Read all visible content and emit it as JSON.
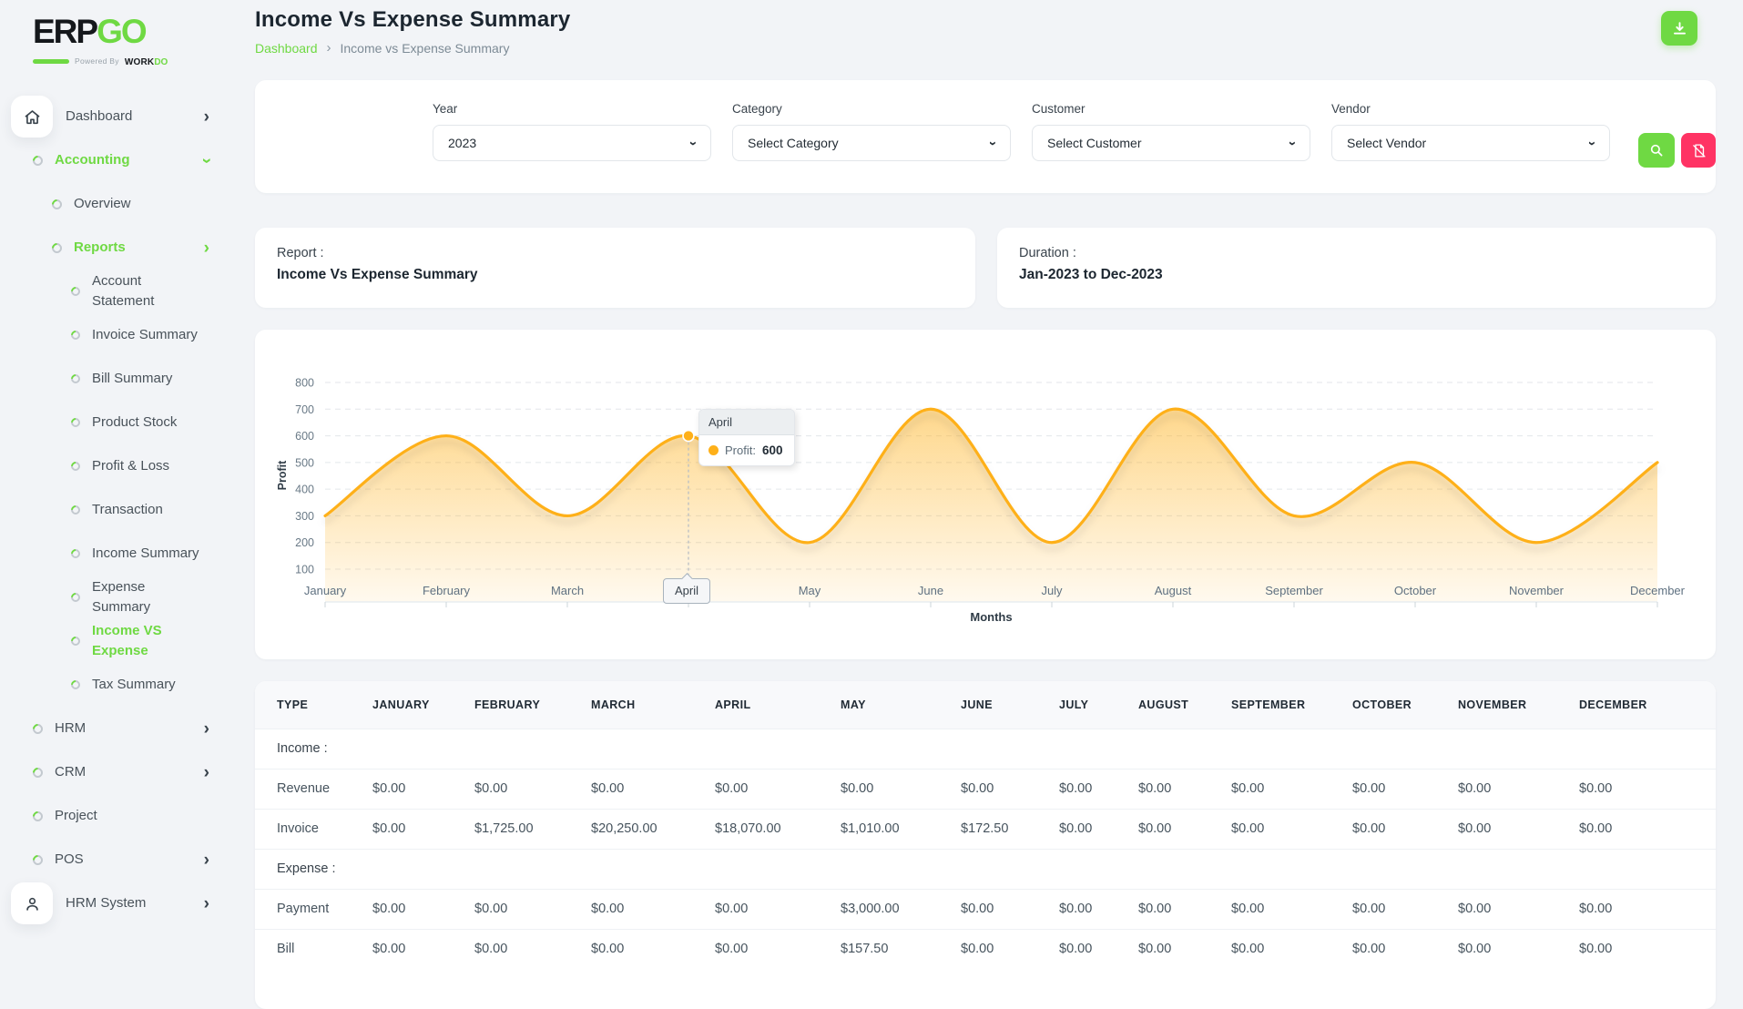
{
  "brand": {
    "name_black": "ERP",
    "name_green": "GO",
    "powered_by": "Powered By",
    "powered_black": "WORK",
    "powered_green": "DO"
  },
  "header": {
    "title": "Income Vs Expense Summary",
    "breadcrumb_link": "Dashboard",
    "breadcrumb_current": "Income vs Expense Summary"
  },
  "filters": {
    "fields": [
      {
        "name": "year-select",
        "label": "Year",
        "value": "2023"
      },
      {
        "name": "category-select",
        "label": "Category",
        "value": "Select Category"
      },
      {
        "name": "customer-select",
        "label": "Customer",
        "value": "Select Customer"
      },
      {
        "name": "vendor-select",
        "label": "Vendor",
        "value": "Select Vendor"
      }
    ]
  },
  "summary_cards": {
    "report_label": "Report :",
    "report_value": "Income Vs Expense Summary",
    "duration_label": "Duration :",
    "duration_value": "Jan-2023 to Dec-2023"
  },
  "sidebar": {
    "items": [
      {
        "name": "sidebar-item-dashboard",
        "label": "Dashboard",
        "level": "main",
        "icon": "home-icon",
        "chevron": "right",
        "active": false
      },
      {
        "name": "sidebar-item-accounting",
        "label": "Accounting",
        "level": "main",
        "bullet": true,
        "chevron": "down",
        "active": true
      },
      {
        "name": "sidebar-item-overview",
        "label": "Overview",
        "level": "sub",
        "bullet": true,
        "active": false
      },
      {
        "name": "sidebar-item-reports",
        "label": "Reports",
        "level": "sub",
        "bullet": true,
        "chevron": "right-green",
        "active": true
      },
      {
        "name": "sidebar-item-account-statement",
        "label": "Account Statement",
        "level": "subsub",
        "bullet": true,
        "active": false
      },
      {
        "name": "sidebar-item-invoice-summary",
        "label": "Invoice Summary",
        "level": "subsub",
        "bullet": true,
        "active": false
      },
      {
        "name": "sidebar-item-bill-summary",
        "label": "Bill Summary",
        "level": "subsub",
        "bullet": true,
        "active": false
      },
      {
        "name": "sidebar-item-product-stock",
        "label": "Product Stock",
        "level": "subsub",
        "bullet": true,
        "active": false
      },
      {
        "name": "sidebar-item-profit-loss",
        "label": "Profit & Loss",
        "level": "subsub",
        "bullet": true,
        "active": false
      },
      {
        "name": "sidebar-item-transaction",
        "label": "Transaction",
        "level": "subsub",
        "bullet": true,
        "active": false
      },
      {
        "name": "sidebar-item-income-summary",
        "label": "Income Summary",
        "level": "subsub",
        "bullet": true,
        "active": false
      },
      {
        "name": "sidebar-item-expense-summary",
        "label": "Expense Summary",
        "level": "subsub",
        "bullet": true,
        "active": false
      },
      {
        "name": "sidebar-item-income-vs-expense",
        "label": "Income VS Expense",
        "level": "subsub",
        "bullet": true,
        "active": true
      },
      {
        "name": "sidebar-item-tax-summary",
        "label": "Tax Summary",
        "level": "subsub",
        "bullet": true,
        "active": false
      },
      {
        "name": "sidebar-item-hrm",
        "label": "HRM",
        "level": "main",
        "bullet": true,
        "chevron": "right",
        "active": false
      },
      {
        "name": "sidebar-item-crm",
        "label": "CRM",
        "level": "main",
        "bullet": true,
        "chevron": "right",
        "active": false
      },
      {
        "name": "sidebar-item-project",
        "label": "Project",
        "level": "main",
        "bullet": true,
        "active": false
      },
      {
        "name": "sidebar-item-pos",
        "label": "POS",
        "level": "main",
        "bullet": true,
        "chevron": "right",
        "active": false
      },
      {
        "name": "sidebar-item-hrm-system",
        "label": "HRM System",
        "level": "main",
        "icon": "user-icon",
        "chevron": "right",
        "active": false
      }
    ]
  },
  "chart_data": {
    "type": "area",
    "x": [
      "January",
      "February",
      "March",
      "April",
      "May",
      "June",
      "July",
      "August",
      "September",
      "October",
      "November",
      "December"
    ],
    "series": [
      {
        "name": "Profit",
        "values": [
          300,
          600,
          300,
          600,
          200,
          700,
          200,
          700,
          300,
          500,
          200,
          500
        ]
      }
    ],
    "xlabel": "Months",
    "ylabel": "Profit",
    "ylim": [
      100,
      800
    ],
    "yticks": [
      800,
      700,
      600,
      500,
      400,
      300,
      200,
      100
    ],
    "grid": "horizontal-dashed",
    "legend": "none",
    "line_color": "#feb019",
    "tooltip": {
      "month": "April",
      "series_label": "Profit:",
      "value": "600"
    }
  },
  "table": {
    "columns": [
      "TYPE",
      "JANUARY",
      "FEBRUARY",
      "MARCH",
      "APRIL",
      "MAY",
      "JUNE",
      "JULY",
      "AUGUST",
      "SEPTEMBER",
      "OCTOBER",
      "NOVEMBER",
      "DECEMBER"
    ],
    "sections": [
      {
        "label": "Income :",
        "rows": [
          {
            "type": "Revenue",
            "values": [
              "$0.00",
              "$0.00",
              "$0.00",
              "$0.00",
              "$0.00",
              "$0.00",
              "$0.00",
              "$0.00",
              "$0.00",
              "$0.00",
              "$0.00",
              "$0.00"
            ]
          },
          {
            "type": "Invoice",
            "values": [
              "$0.00",
              "$1,725.00",
              "$20,250.00",
              "$18,070.00",
              "$1,010.00",
              "$172.50",
              "$0.00",
              "$0.00",
              "$0.00",
              "$0.00",
              "$0.00",
              "$0.00"
            ]
          }
        ]
      },
      {
        "label": "Expense :",
        "rows": [
          {
            "type": "Payment",
            "values": [
              "$0.00",
              "$0.00",
              "$0.00",
              "$0.00",
              "$3,000.00",
              "$0.00",
              "$0.00",
              "$0.00",
              "$0.00",
              "$0.00",
              "$0.00",
              "$0.00"
            ]
          },
          {
            "type": "Bill",
            "values": [
              "$0.00",
              "$0.00",
              "$0.00",
              "$0.00",
              "$157.50",
              "$0.00",
              "$0.00",
              "$0.00",
              "$0.00",
              "$0.00",
              "$0.00",
              "$0.00"
            ]
          }
        ]
      }
    ]
  },
  "colors": {
    "accent_green": "#6fd943",
    "danger_pink": "#ff3364",
    "chart_orange": "#feb019"
  }
}
